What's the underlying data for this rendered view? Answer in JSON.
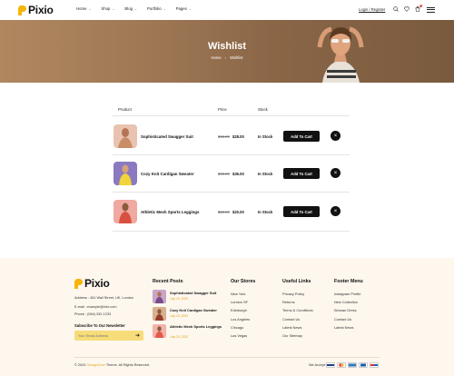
{
  "header": {
    "brand": "Pixio",
    "nav": [
      "Home",
      "Shop",
      "Blog",
      "Portfolio",
      "Pages"
    ],
    "login": "Login / Register",
    "cart_count": "0"
  },
  "banner": {
    "title": "Wishlist",
    "crumb_home": "Home",
    "crumb_sep": "›",
    "crumb_current": "Wishlist"
  },
  "table": {
    "headers": [
      "Product",
      "Price",
      "Stock"
    ],
    "rows": [
      {
        "name": "Sophisticated Swagger Suit",
        "old_price": "$45.00",
        "price": "$28.00",
        "stock": "In Stock",
        "cart": "Add To Cart"
      },
      {
        "name": "Cozy Knit Cardigan Sweater",
        "old_price": "$45.00",
        "price": "$36.00",
        "stock": "In Stock",
        "cart": "Add To Cart"
      },
      {
        "name": "Athletic Mesh Sports Leggings",
        "old_price": "$36.00",
        "price": "$20.00",
        "stock": "In Stock",
        "cart": "Add To Cart"
      }
    ]
  },
  "footer": {
    "brand": "Pixio",
    "address": "Address : 451 Wall Street, UK, London",
    "email": "E-mail : example@info.com",
    "phone": "Phone : (064) 332-1233",
    "subscribe_title": "Subscribe To Our Newsletter",
    "email_placeholder": "Your Email Address",
    "recent_posts_title": "Recent Posts",
    "posts": [
      {
        "title": "Sophisticated Swagger Suit",
        "date": "July 23, 2023"
      },
      {
        "title": "Cozy Knit Cardigan Sweater",
        "date": "July 23, 2023"
      },
      {
        "title": "Athletic Mesh Sports Leggings",
        "date": "July 23, 2023"
      }
    ],
    "stores_title": "Our Stores",
    "stores": [
      "New York",
      "London SF",
      "Edinburgh",
      "Los Angeles",
      "Chicago",
      "Las Vegas"
    ],
    "useful_title": "Useful Links",
    "useful": [
      "Privacy Policy",
      "Returns",
      "Terms & Conditions",
      "Contact Us",
      "Latest News",
      "Our Sitemap"
    ],
    "menu_title": "Footer Menu",
    "menu": [
      "Instagram Profile",
      "New Collection",
      "Woman Dress",
      "Contact Us",
      "Latest News"
    ],
    "copyright_prefix": "© 2024",
    "copyright_brand": "DexignZone",
    "copyright_suffix": "Theme. All Rights Reserved.",
    "we_accept": "We Accept:"
  },
  "colors": {
    "accent": "#f5b50a",
    "footer_bg": "#fdf7ee",
    "email_bg": "#f7dc7a",
    "banner": "#9a7452"
  }
}
